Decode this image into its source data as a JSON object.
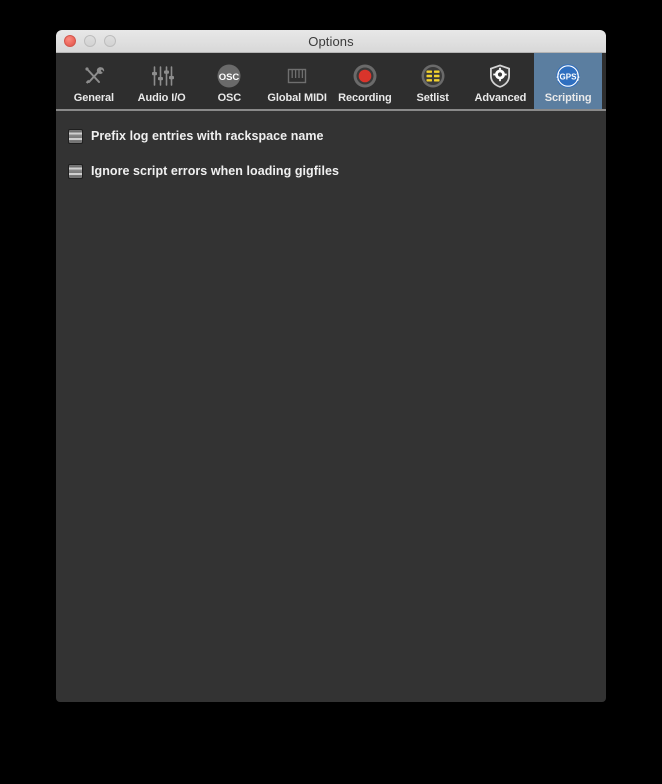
{
  "window": {
    "title": "Options",
    "traffic_lights": [
      {
        "name": "close",
        "color": "#ee6a5f"
      },
      {
        "name": "minimize",
        "color": "#d6d6d6"
      },
      {
        "name": "maximize",
        "color": "#d6d6d6"
      }
    ]
  },
  "toolbar": {
    "selected_tab": "Scripting",
    "selected_color": "#5b7ea0",
    "tabs": [
      {
        "label": "General",
        "icon": "tools-icon",
        "selected": false
      },
      {
        "label": "Audio I/O",
        "icon": "sliders-icon",
        "selected": false
      },
      {
        "label": "OSC",
        "icon": "osc-icon",
        "selected": false
      },
      {
        "label": "Global MIDI",
        "icon": "piano-keys-icon",
        "selected": false
      },
      {
        "label": "Recording",
        "icon": "record-dot-icon",
        "selected": false
      },
      {
        "label": "Setlist",
        "icon": "setlist-icon",
        "selected": false
      },
      {
        "label": "Advanced",
        "icon": "shield-gear-icon",
        "selected": false
      },
      {
        "label": "Scripting",
        "icon": "gps-badge-icon",
        "selected": true
      }
    ],
    "osc_badge_text": "OSC",
    "gps_badge_text": "{GPS}"
  },
  "content": {
    "options": [
      {
        "label": "Prefix log entries with rackspace name",
        "checked": false
      },
      {
        "label": "Ignore script errors when loading gigfiles",
        "checked": false
      }
    ]
  },
  "colors": {
    "desktop": "#000000",
    "titlebar": "#e0e0e0",
    "toolbar": "#2e2e2e",
    "content": "#333333",
    "separator": "#8a8a8a",
    "accent": "#5b7ea0",
    "record_red": "#d9342b",
    "setlist_yellow": "#f2d22e"
  }
}
